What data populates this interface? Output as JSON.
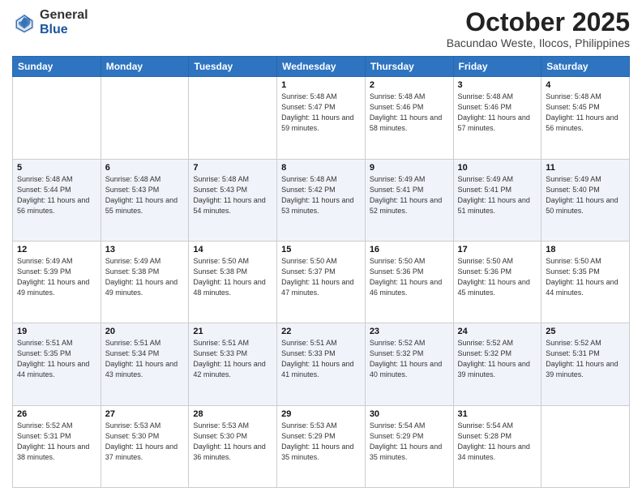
{
  "header": {
    "logo_general": "General",
    "logo_blue": "Blue",
    "month": "October 2025",
    "location": "Bacundao Weste, Ilocos, Philippines"
  },
  "weekdays": [
    "Sunday",
    "Monday",
    "Tuesday",
    "Wednesday",
    "Thursday",
    "Friday",
    "Saturday"
  ],
  "weeks": [
    [
      {
        "day": "",
        "sunrise": "",
        "sunset": "",
        "daylight": ""
      },
      {
        "day": "",
        "sunrise": "",
        "sunset": "",
        "daylight": ""
      },
      {
        "day": "",
        "sunrise": "",
        "sunset": "",
        "daylight": ""
      },
      {
        "day": "1",
        "sunrise": "Sunrise: 5:48 AM",
        "sunset": "Sunset: 5:47 PM",
        "daylight": "Daylight: 11 hours and 59 minutes."
      },
      {
        "day": "2",
        "sunrise": "Sunrise: 5:48 AM",
        "sunset": "Sunset: 5:46 PM",
        "daylight": "Daylight: 11 hours and 58 minutes."
      },
      {
        "day": "3",
        "sunrise": "Sunrise: 5:48 AM",
        "sunset": "Sunset: 5:46 PM",
        "daylight": "Daylight: 11 hours and 57 minutes."
      },
      {
        "day": "4",
        "sunrise": "Sunrise: 5:48 AM",
        "sunset": "Sunset: 5:45 PM",
        "daylight": "Daylight: 11 hours and 56 minutes."
      }
    ],
    [
      {
        "day": "5",
        "sunrise": "Sunrise: 5:48 AM",
        "sunset": "Sunset: 5:44 PM",
        "daylight": "Daylight: 11 hours and 56 minutes."
      },
      {
        "day": "6",
        "sunrise": "Sunrise: 5:48 AM",
        "sunset": "Sunset: 5:43 PM",
        "daylight": "Daylight: 11 hours and 55 minutes."
      },
      {
        "day": "7",
        "sunrise": "Sunrise: 5:48 AM",
        "sunset": "Sunset: 5:43 PM",
        "daylight": "Daylight: 11 hours and 54 minutes."
      },
      {
        "day": "8",
        "sunrise": "Sunrise: 5:48 AM",
        "sunset": "Sunset: 5:42 PM",
        "daylight": "Daylight: 11 hours and 53 minutes."
      },
      {
        "day": "9",
        "sunrise": "Sunrise: 5:49 AM",
        "sunset": "Sunset: 5:41 PM",
        "daylight": "Daylight: 11 hours and 52 minutes."
      },
      {
        "day": "10",
        "sunrise": "Sunrise: 5:49 AM",
        "sunset": "Sunset: 5:41 PM",
        "daylight": "Daylight: 11 hours and 51 minutes."
      },
      {
        "day": "11",
        "sunrise": "Sunrise: 5:49 AM",
        "sunset": "Sunset: 5:40 PM",
        "daylight": "Daylight: 11 hours and 50 minutes."
      }
    ],
    [
      {
        "day": "12",
        "sunrise": "Sunrise: 5:49 AM",
        "sunset": "Sunset: 5:39 PM",
        "daylight": "Daylight: 11 hours and 49 minutes."
      },
      {
        "day": "13",
        "sunrise": "Sunrise: 5:49 AM",
        "sunset": "Sunset: 5:38 PM",
        "daylight": "Daylight: 11 hours and 49 minutes."
      },
      {
        "day": "14",
        "sunrise": "Sunrise: 5:50 AM",
        "sunset": "Sunset: 5:38 PM",
        "daylight": "Daylight: 11 hours and 48 minutes."
      },
      {
        "day": "15",
        "sunrise": "Sunrise: 5:50 AM",
        "sunset": "Sunset: 5:37 PM",
        "daylight": "Daylight: 11 hours and 47 minutes."
      },
      {
        "day": "16",
        "sunrise": "Sunrise: 5:50 AM",
        "sunset": "Sunset: 5:36 PM",
        "daylight": "Daylight: 11 hours and 46 minutes."
      },
      {
        "day": "17",
        "sunrise": "Sunrise: 5:50 AM",
        "sunset": "Sunset: 5:36 PM",
        "daylight": "Daylight: 11 hours and 45 minutes."
      },
      {
        "day": "18",
        "sunrise": "Sunrise: 5:50 AM",
        "sunset": "Sunset: 5:35 PM",
        "daylight": "Daylight: 11 hours and 44 minutes."
      }
    ],
    [
      {
        "day": "19",
        "sunrise": "Sunrise: 5:51 AM",
        "sunset": "Sunset: 5:35 PM",
        "daylight": "Daylight: 11 hours and 44 minutes."
      },
      {
        "day": "20",
        "sunrise": "Sunrise: 5:51 AM",
        "sunset": "Sunset: 5:34 PM",
        "daylight": "Daylight: 11 hours and 43 minutes."
      },
      {
        "day": "21",
        "sunrise": "Sunrise: 5:51 AM",
        "sunset": "Sunset: 5:33 PM",
        "daylight": "Daylight: 11 hours and 42 minutes."
      },
      {
        "day": "22",
        "sunrise": "Sunrise: 5:51 AM",
        "sunset": "Sunset: 5:33 PM",
        "daylight": "Daylight: 11 hours and 41 minutes."
      },
      {
        "day": "23",
        "sunrise": "Sunrise: 5:52 AM",
        "sunset": "Sunset: 5:32 PM",
        "daylight": "Daylight: 11 hours and 40 minutes."
      },
      {
        "day": "24",
        "sunrise": "Sunrise: 5:52 AM",
        "sunset": "Sunset: 5:32 PM",
        "daylight": "Daylight: 11 hours and 39 minutes."
      },
      {
        "day": "25",
        "sunrise": "Sunrise: 5:52 AM",
        "sunset": "Sunset: 5:31 PM",
        "daylight": "Daylight: 11 hours and 39 minutes."
      }
    ],
    [
      {
        "day": "26",
        "sunrise": "Sunrise: 5:52 AM",
        "sunset": "Sunset: 5:31 PM",
        "daylight": "Daylight: 11 hours and 38 minutes."
      },
      {
        "day": "27",
        "sunrise": "Sunrise: 5:53 AM",
        "sunset": "Sunset: 5:30 PM",
        "daylight": "Daylight: 11 hours and 37 minutes."
      },
      {
        "day": "28",
        "sunrise": "Sunrise: 5:53 AM",
        "sunset": "Sunset: 5:30 PM",
        "daylight": "Daylight: 11 hours and 36 minutes."
      },
      {
        "day": "29",
        "sunrise": "Sunrise: 5:53 AM",
        "sunset": "Sunset: 5:29 PM",
        "daylight": "Daylight: 11 hours and 35 minutes."
      },
      {
        "day": "30",
        "sunrise": "Sunrise: 5:54 AM",
        "sunset": "Sunset: 5:29 PM",
        "daylight": "Daylight: 11 hours and 35 minutes."
      },
      {
        "day": "31",
        "sunrise": "Sunrise: 5:54 AM",
        "sunset": "Sunset: 5:28 PM",
        "daylight": "Daylight: 11 hours and 34 minutes."
      },
      {
        "day": "",
        "sunrise": "",
        "sunset": "",
        "daylight": ""
      }
    ]
  ]
}
